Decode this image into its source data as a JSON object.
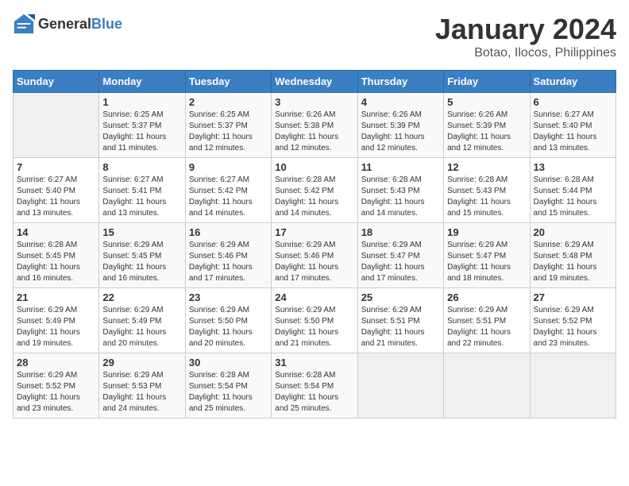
{
  "header": {
    "logo_general": "General",
    "logo_blue": "Blue",
    "title": "January 2024",
    "subtitle": "Botao, Ilocos, Philippines"
  },
  "days_of_week": [
    "Sunday",
    "Monday",
    "Tuesday",
    "Wednesday",
    "Thursday",
    "Friday",
    "Saturday"
  ],
  "weeks": [
    [
      {
        "day": "",
        "info": ""
      },
      {
        "day": "1",
        "info": "Sunrise: 6:25 AM\nSunset: 5:37 PM\nDaylight: 11 hours\nand 11 minutes."
      },
      {
        "day": "2",
        "info": "Sunrise: 6:25 AM\nSunset: 5:37 PM\nDaylight: 11 hours\nand 12 minutes."
      },
      {
        "day": "3",
        "info": "Sunrise: 6:26 AM\nSunset: 5:38 PM\nDaylight: 11 hours\nand 12 minutes."
      },
      {
        "day": "4",
        "info": "Sunrise: 6:26 AM\nSunset: 5:39 PM\nDaylight: 11 hours\nand 12 minutes."
      },
      {
        "day": "5",
        "info": "Sunrise: 6:26 AM\nSunset: 5:39 PM\nDaylight: 11 hours\nand 12 minutes."
      },
      {
        "day": "6",
        "info": "Sunrise: 6:27 AM\nSunset: 5:40 PM\nDaylight: 11 hours\nand 13 minutes."
      }
    ],
    [
      {
        "day": "7",
        "info": "Sunrise: 6:27 AM\nSunset: 5:40 PM\nDaylight: 11 hours\nand 13 minutes."
      },
      {
        "day": "8",
        "info": "Sunrise: 6:27 AM\nSunset: 5:41 PM\nDaylight: 11 hours\nand 13 minutes."
      },
      {
        "day": "9",
        "info": "Sunrise: 6:27 AM\nSunset: 5:42 PM\nDaylight: 11 hours\nand 14 minutes."
      },
      {
        "day": "10",
        "info": "Sunrise: 6:28 AM\nSunset: 5:42 PM\nDaylight: 11 hours\nand 14 minutes."
      },
      {
        "day": "11",
        "info": "Sunrise: 6:28 AM\nSunset: 5:43 PM\nDaylight: 11 hours\nand 14 minutes."
      },
      {
        "day": "12",
        "info": "Sunrise: 6:28 AM\nSunset: 5:43 PM\nDaylight: 11 hours\nand 15 minutes."
      },
      {
        "day": "13",
        "info": "Sunrise: 6:28 AM\nSunset: 5:44 PM\nDaylight: 11 hours\nand 15 minutes."
      }
    ],
    [
      {
        "day": "14",
        "info": "Sunrise: 6:28 AM\nSunset: 5:45 PM\nDaylight: 11 hours\nand 16 minutes."
      },
      {
        "day": "15",
        "info": "Sunrise: 6:29 AM\nSunset: 5:45 PM\nDaylight: 11 hours\nand 16 minutes."
      },
      {
        "day": "16",
        "info": "Sunrise: 6:29 AM\nSunset: 5:46 PM\nDaylight: 11 hours\nand 17 minutes."
      },
      {
        "day": "17",
        "info": "Sunrise: 6:29 AM\nSunset: 5:46 PM\nDaylight: 11 hours\nand 17 minutes."
      },
      {
        "day": "18",
        "info": "Sunrise: 6:29 AM\nSunset: 5:47 PM\nDaylight: 11 hours\nand 17 minutes."
      },
      {
        "day": "19",
        "info": "Sunrise: 6:29 AM\nSunset: 5:47 PM\nDaylight: 11 hours\nand 18 minutes."
      },
      {
        "day": "20",
        "info": "Sunrise: 6:29 AM\nSunset: 5:48 PM\nDaylight: 11 hours\nand 19 minutes."
      }
    ],
    [
      {
        "day": "21",
        "info": "Sunrise: 6:29 AM\nSunset: 5:49 PM\nDaylight: 11 hours\nand 19 minutes."
      },
      {
        "day": "22",
        "info": "Sunrise: 6:29 AM\nSunset: 5:49 PM\nDaylight: 11 hours\nand 20 minutes."
      },
      {
        "day": "23",
        "info": "Sunrise: 6:29 AM\nSunset: 5:50 PM\nDaylight: 11 hours\nand 20 minutes."
      },
      {
        "day": "24",
        "info": "Sunrise: 6:29 AM\nSunset: 5:50 PM\nDaylight: 11 hours\nand 21 minutes."
      },
      {
        "day": "25",
        "info": "Sunrise: 6:29 AM\nSunset: 5:51 PM\nDaylight: 11 hours\nand 21 minutes."
      },
      {
        "day": "26",
        "info": "Sunrise: 6:29 AM\nSunset: 5:51 PM\nDaylight: 11 hours\nand 22 minutes."
      },
      {
        "day": "27",
        "info": "Sunrise: 6:29 AM\nSunset: 5:52 PM\nDaylight: 11 hours\nand 23 minutes."
      }
    ],
    [
      {
        "day": "28",
        "info": "Sunrise: 6:29 AM\nSunset: 5:52 PM\nDaylight: 11 hours\nand 23 minutes."
      },
      {
        "day": "29",
        "info": "Sunrise: 6:29 AM\nSunset: 5:53 PM\nDaylight: 11 hours\nand 24 minutes."
      },
      {
        "day": "30",
        "info": "Sunrise: 6:28 AM\nSunset: 5:54 PM\nDaylight: 11 hours\nand 25 minutes."
      },
      {
        "day": "31",
        "info": "Sunrise: 6:28 AM\nSunset: 5:54 PM\nDaylight: 11 hours\nand 25 minutes."
      },
      {
        "day": "",
        "info": ""
      },
      {
        "day": "",
        "info": ""
      },
      {
        "day": "",
        "info": ""
      }
    ]
  ]
}
